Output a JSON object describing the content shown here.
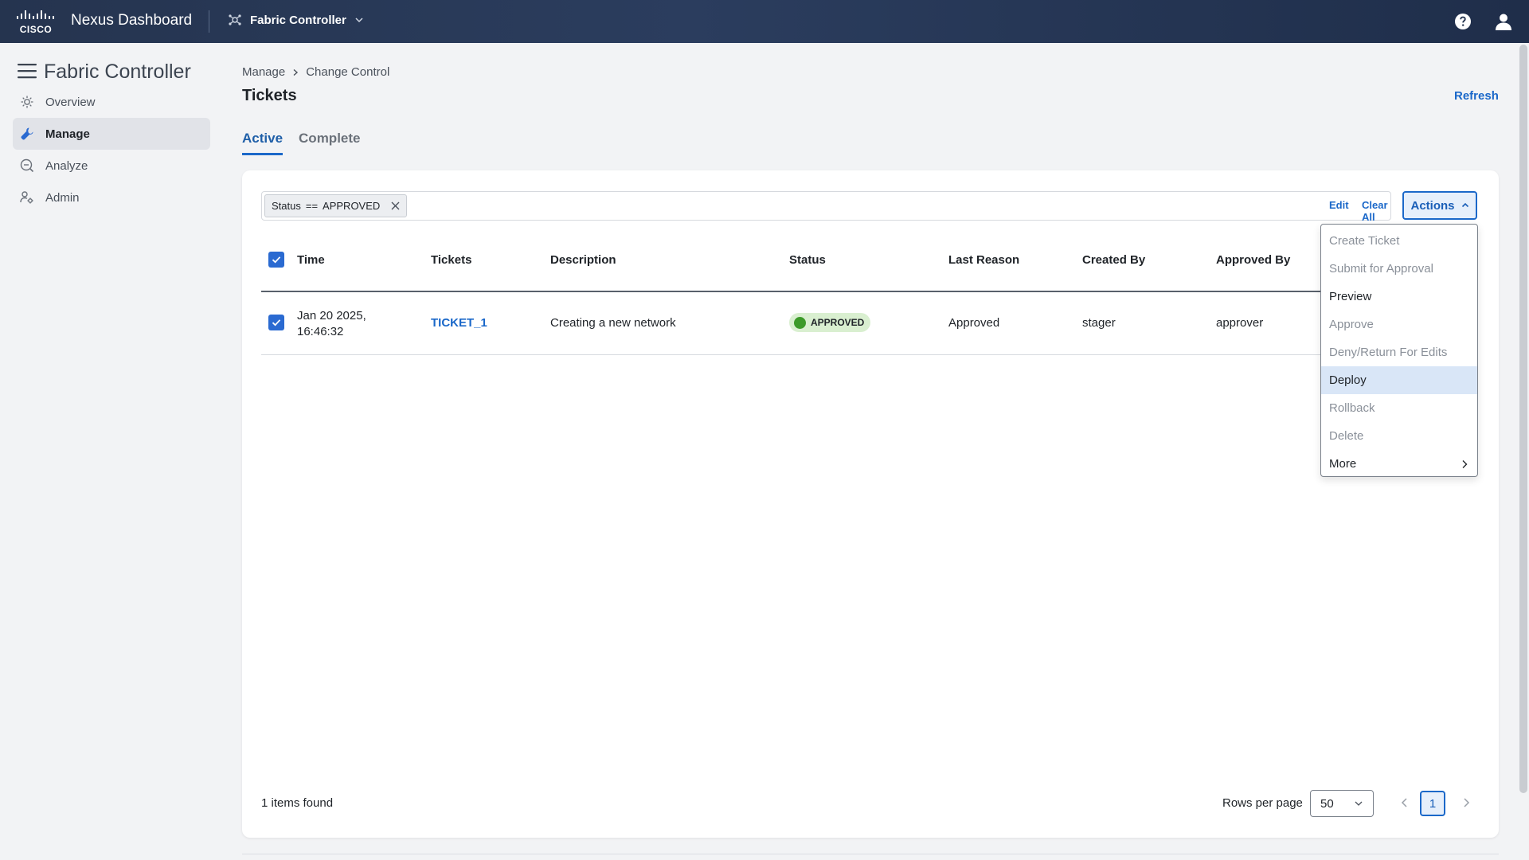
{
  "topbar": {
    "logo_text": "CISCO",
    "app_name": "Nexus Dashboard",
    "service": "Fabric Controller"
  },
  "sidebar": {
    "title": "Fabric Controller",
    "items": [
      {
        "label": "Overview",
        "icon": "overview-icon",
        "active": false
      },
      {
        "label": "Manage",
        "icon": "wrench-icon",
        "active": true
      },
      {
        "label": "Analyze",
        "icon": "analyze-icon",
        "active": false
      },
      {
        "label": "Admin",
        "icon": "admin-user-gear-icon",
        "active": false
      }
    ]
  },
  "main": {
    "breadcrumb": [
      "Manage",
      "Change Control"
    ],
    "title": "Tickets",
    "refresh_label": "Refresh",
    "tabs": [
      {
        "label": "Active",
        "active": true
      },
      {
        "label": "Complete",
        "active": false
      }
    ]
  },
  "filter": {
    "chip": {
      "field": "Status",
      "op": "==",
      "value": "APPROVED"
    },
    "edit_label": "Edit",
    "clear_label": "Clear All"
  },
  "actions": {
    "label": "Actions",
    "open": true,
    "items": [
      {
        "label": "Create Ticket",
        "enabled": false
      },
      {
        "label": "Submit for Approval",
        "enabled": false
      },
      {
        "label": "Preview",
        "enabled": true
      },
      {
        "label": "Approve",
        "enabled": false
      },
      {
        "label": "Deny/Return For Edits",
        "enabled": false
      },
      {
        "label": "Deploy",
        "enabled": true,
        "hovered": true
      },
      {
        "label": "Rollback",
        "enabled": false
      },
      {
        "label": "Delete",
        "enabled": false
      },
      {
        "label": "More",
        "enabled": true,
        "submenu": true
      }
    ]
  },
  "table": {
    "columns": [
      "Time",
      "Tickets",
      "Description",
      "Status",
      "Last Reason",
      "Created By",
      "Approved By"
    ],
    "rows": [
      {
        "selected": true,
        "time_line1": "Jan 20 2025,",
        "time_line2": "16:46:32",
        "ticket": "TICKET_1",
        "description": "Creating a new network",
        "status": "APPROVED",
        "last_reason": "Approved",
        "created_by": "stager",
        "approved_by": "approver"
      }
    ]
  },
  "footer": {
    "items_found": "1 items found",
    "rows_per_page_label": "Rows per page",
    "rows_per_page_value": "50",
    "current_page": "1"
  },
  "colors": {
    "accent": "#1b68c9",
    "status_approved": "#3c9a29",
    "status_badge_bg": "#d9efd0",
    "topbar": "#25344f"
  }
}
